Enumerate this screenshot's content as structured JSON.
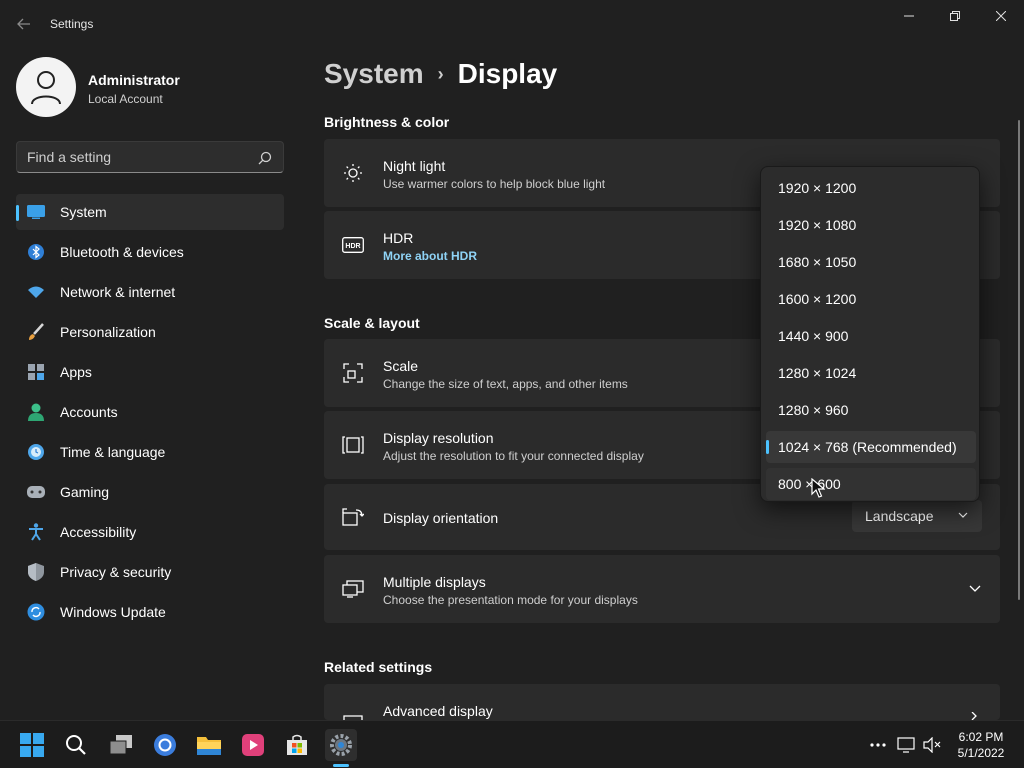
{
  "window": {
    "title": "Settings",
    "controls": {
      "minimize": "minimize-icon",
      "maximize": "restore-icon",
      "close": "close-icon"
    }
  },
  "account": {
    "name": "Administrator",
    "type": "Local Account"
  },
  "search": {
    "placeholder": "Find a setting"
  },
  "sidebar": {
    "items": [
      {
        "label": "System",
        "icon": "system-icon",
        "selected": true
      },
      {
        "label": "Bluetooth & devices",
        "icon": "bluetooth-icon"
      },
      {
        "label": "Network & internet",
        "icon": "wifi-icon"
      },
      {
        "label": "Personalization",
        "icon": "brush-icon"
      },
      {
        "label": "Apps",
        "icon": "apps-icon"
      },
      {
        "label": "Accounts",
        "icon": "accounts-icon"
      },
      {
        "label": "Time & language",
        "icon": "clock-globe-icon"
      },
      {
        "label": "Gaming",
        "icon": "controller-icon"
      },
      {
        "label": "Accessibility",
        "icon": "accessibility-icon"
      },
      {
        "label": "Privacy & security",
        "icon": "shield-icon"
      },
      {
        "label": "Windows Update",
        "icon": "update-icon"
      }
    ]
  },
  "breadcrumb": {
    "parent": "System",
    "separator": "›",
    "current": "Display"
  },
  "sections": {
    "brightness": "Brightness & color",
    "scale_layout": "Scale & layout",
    "related": "Related settings"
  },
  "cards": {
    "night_light": {
      "title": "Night light",
      "subtitle": "Use warmer colors to help block blue light"
    },
    "hdr": {
      "title": "HDR",
      "link": "More about HDR"
    },
    "scale": {
      "title": "Scale",
      "subtitle": "Change the size of text, apps, and other items"
    },
    "resolution": {
      "title": "Display resolution",
      "subtitle": "Adjust the resolution to fit your connected display"
    },
    "orientation": {
      "title": "Display orientation",
      "value": "Landscape"
    },
    "multiple": {
      "title": "Multiple displays",
      "subtitle": "Choose the presentation mode for your displays"
    },
    "advanced": {
      "title": "Advanced display"
    }
  },
  "resolution_dropdown": {
    "options": [
      "1920 × 1200",
      "1920 × 1080",
      "1680 × 1050",
      "1600 × 1200",
      "1440 × 900",
      "1280 × 1024",
      "1280 × 960",
      "1024 × 768 (Recommended)",
      "800 × 600"
    ],
    "selected_index": 7,
    "hover_index": 8
  },
  "taskbar": {
    "apps": [
      "start-icon",
      "search-icon",
      "task-view-icon",
      "chrome-icon",
      "file-explorer-icon",
      "media-player-icon",
      "store-icon",
      "settings-icon"
    ],
    "clock": {
      "time": "6:02 PM",
      "date": "5/1/2022"
    }
  },
  "colors": {
    "accent": "#4cc2ff",
    "link": "#8fd3f6",
    "background": "#202020",
    "card": "#2b2b2b"
  }
}
